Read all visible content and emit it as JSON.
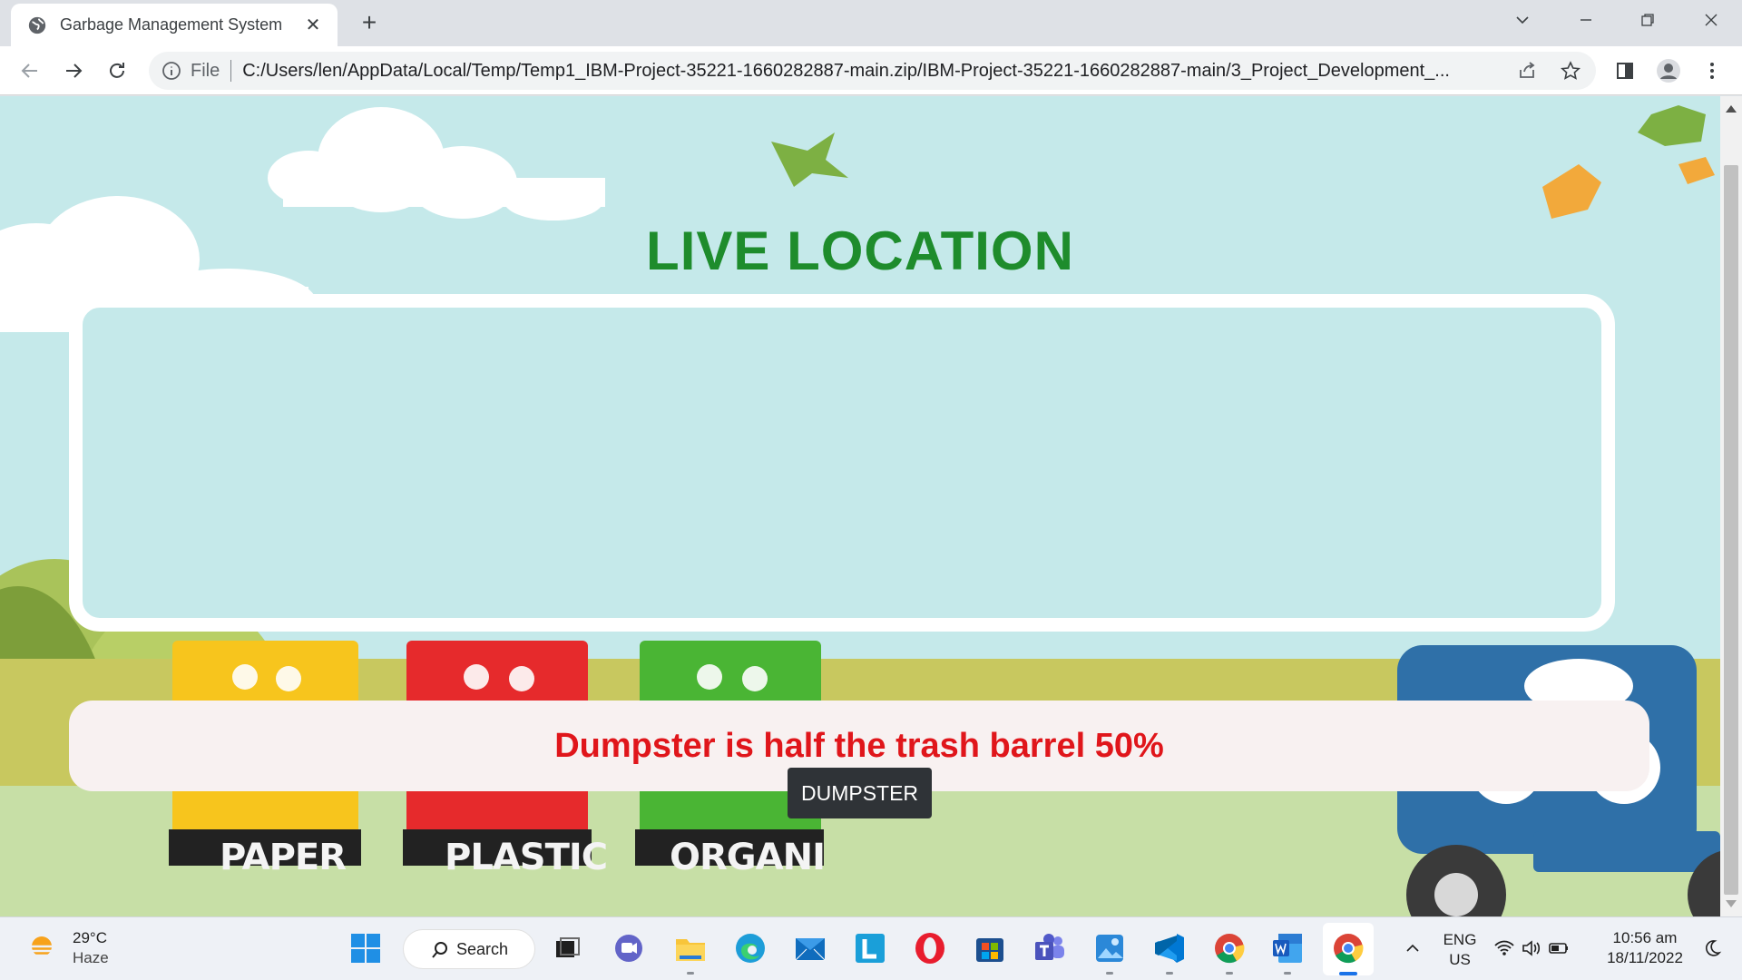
{
  "browser": {
    "tab_title": "Garbage Management System",
    "file_label": "File",
    "url": "C:/Users/len/AppData/Local/Temp/Temp1_IBM-Project-35221-1660282887-main.zip/IBM-Project-35221-1660282887-main/3_Project_Development_..."
  },
  "page": {
    "title": "LIVE LOCATION",
    "status_message": "Dumpster is half the trash barrel 50%",
    "fill_level_percent": 50,
    "tooltip": "DUMPSTER",
    "background_bins": [
      "PAPER",
      "PLASTIC",
      "ORGANI"
    ],
    "colors": {
      "title": "#1e8c2c",
      "status": "#e0161b",
      "sky": "#c5e9ea"
    }
  },
  "taskbar": {
    "weather_temp": "29°C",
    "weather_desc": "Haze",
    "search_label": "Search",
    "lang_top": "ENG",
    "lang_bottom": "US",
    "time": "10:56 am",
    "date": "18/11/2022",
    "apps": [
      "start-icon",
      "search",
      "task-view-icon",
      "chat-icon",
      "file-explorer-icon",
      "edge-icon",
      "mail-icon",
      "l-app-icon",
      "opera-icon",
      "store-icon",
      "teams-icon",
      "photos-icon",
      "vscode-icon",
      "chrome-icon",
      "word-icon",
      "chrome-active-icon"
    ]
  }
}
